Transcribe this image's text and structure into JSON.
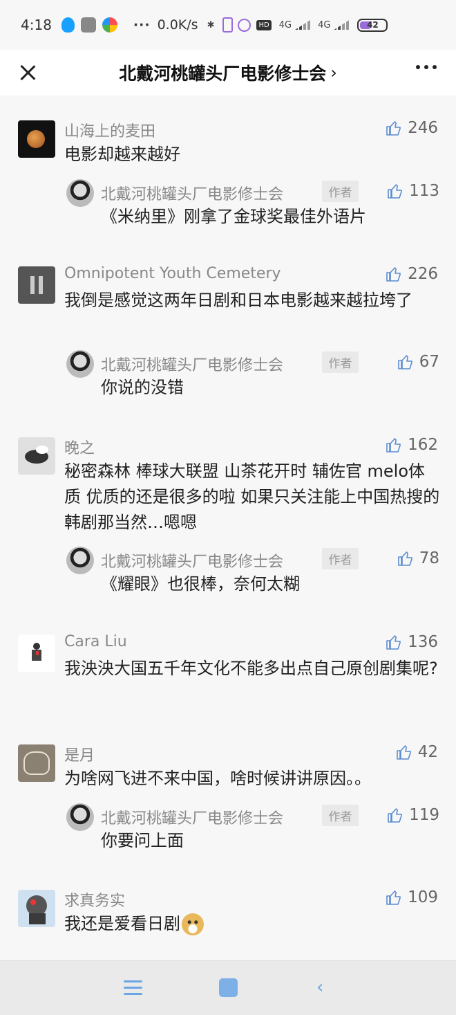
{
  "status_bar": {
    "time": "4:18",
    "dots": "···",
    "speed": "0.0K/s",
    "hd": "HD",
    "net1": "4G",
    "net2": "4G",
    "battery": "42"
  },
  "header": {
    "title": "北戴河桃罐头厂电影修士会",
    "chevron": "›"
  },
  "author_badge": "作者",
  "comments": [
    {
      "name": "山海上的麦田",
      "text": "电影却越来越好",
      "likes": "246",
      "reply": {
        "name": "北戴河桃罐头厂电影修士会",
        "text": "《米纳里》刚拿了金球奖最佳外语片",
        "likes": "113"
      }
    },
    {
      "name": "Omnipotent Youth Cemetery",
      "text": "我倒是感觉这两年日剧和日本电影越来越拉垮了",
      "likes": "226",
      "reply": {
        "name": "北戴河桃罐头厂电影修士会",
        "text": "你说的没错",
        "likes": "67"
      }
    },
    {
      "name": "晚之",
      "text": "秘密森林 棒球大联盟 山茶花开时 辅佐官 melo体质 优质的还是很多的啦 如果只关注能上中国热搜的韩剧那当然…嗯嗯",
      "likes": "162",
      "reply": {
        "name": "北戴河桃罐头厂电影修士会",
        "text": "《耀眼》也很棒，奈何太糊",
        "likes": "78"
      }
    },
    {
      "name": "Cara Liu",
      "text": "我泱泱大国五千年文化不能多出点自己原创剧集呢?",
      "likes": "136"
    },
    {
      "name": "是月",
      "text": "为啥网飞进不来中国，啥时候讲讲原因。。",
      "likes": "42",
      "reply": {
        "name": "北戴河桃罐头厂电影修士会",
        "text": "你要问上面",
        "likes": "119"
      }
    },
    {
      "name": "求真务实",
      "text": "我还是爱看日剧",
      "likes": "109"
    }
  ]
}
